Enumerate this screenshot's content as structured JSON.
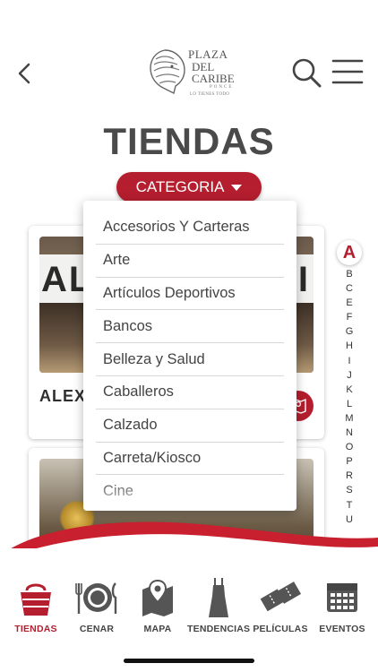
{
  "header": {
    "logo_line1": "PLAZA",
    "logo_line2": "DEL",
    "logo_line3": "CARIBE",
    "logo_line4": "PONCE",
    "logo_tagline": "LO TIENES TODO"
  },
  "page_title": "TIENDAS",
  "category_button": "CATEGORIA",
  "dropdown_items": [
    "Accesorios Y Carteras",
    "Arte",
    "Artículos Deportivos",
    "Bancos",
    "Belleza y Salud",
    "Caballeros",
    "Calzado",
    "Carreta/Kiosco",
    "Cine"
  ],
  "store_cards": [
    {
      "name": "ALEX",
      "sign_left": "AL",
      "sign_right": "I"
    }
  ],
  "alphabet": {
    "active": "A",
    "letters": [
      "B",
      "C",
      "E",
      "F",
      "G",
      "H",
      "I",
      "J",
      "K",
      "L",
      "M",
      "N",
      "O",
      "P",
      "R",
      "S",
      "T",
      "U"
    ]
  },
  "bottom_nav": [
    {
      "label": "TIENDAS",
      "icon": "shopping-basket-icon",
      "active": true
    },
    {
      "label": "CENAR",
      "icon": "dining-plate-icon",
      "active": false
    },
    {
      "label": "MAPA",
      "icon": "map-pin-icon",
      "active": false
    },
    {
      "label": "TENDENCIAS",
      "icon": "dress-icon",
      "active": false
    },
    {
      "label": "PELÍCULAS",
      "icon": "movie-tickets-icon",
      "active": false
    },
    {
      "label": "EVENTOS",
      "icon": "calendar-icon",
      "active": false
    }
  ],
  "colors": {
    "accent": "#b51e2e",
    "text": "#4a4a4a"
  }
}
